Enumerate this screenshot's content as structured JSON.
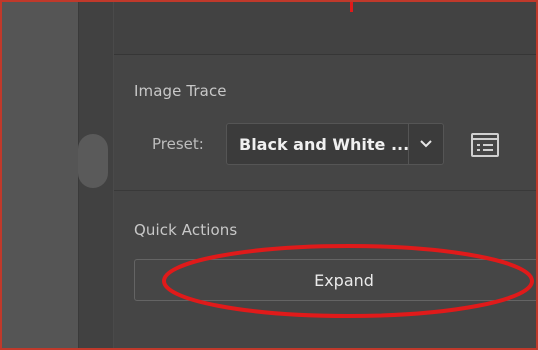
{
  "image_trace": {
    "title": "Image Trace",
    "preset_label": "Preset:",
    "preset_value": "Black and White ...",
    "preset_chevron_icon": "chevron-down-icon",
    "options_icon": "panel-options-icon"
  },
  "quick_actions": {
    "title": "Quick Actions",
    "expand_label": "Expand"
  },
  "colors": {
    "annotation": "#e01a1a",
    "panel_bg": "#454545",
    "text": "#c8c8c8"
  }
}
